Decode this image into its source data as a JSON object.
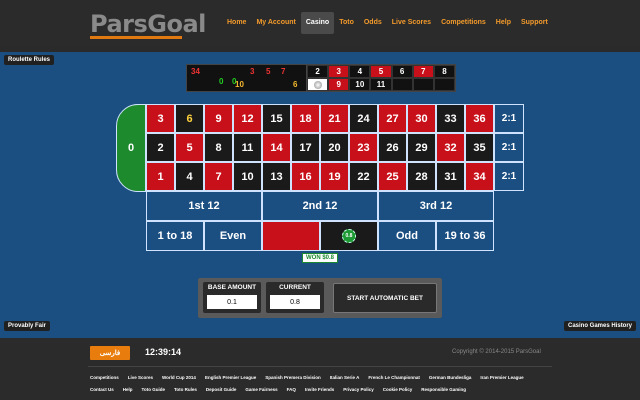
{
  "header": {
    "logo": "ParsGoal",
    "nav": [
      {
        "label": "Home",
        "active": false
      },
      {
        "label": "My Account",
        "active": false
      },
      {
        "label": "Casino",
        "active": true
      },
      {
        "label": "Toto",
        "active": false
      },
      {
        "label": "Odds",
        "active": false
      },
      {
        "label": "Live Scores",
        "active": false
      },
      {
        "label": "Competitions",
        "active": false
      },
      {
        "label": "Help",
        "active": false
      },
      {
        "label": "Support",
        "active": false
      }
    ]
  },
  "game": {
    "roulette_rules": "Roulette Rules",
    "provably_fair": "Provably Fair",
    "history_link": "Casino Games History",
    "stats": [
      {
        "value": "34",
        "color": "#e33"
      },
      {
        "value": "0",
        "color": "#2c2"
      },
      {
        "value": "0",
        "color": "#2c2"
      },
      {
        "value": "3",
        "color": "#e33"
      },
      {
        "value": "5",
        "color": "#e33"
      },
      {
        "value": "7",
        "color": "#e33"
      },
      {
        "value": "10",
        "color": "#f5b82e"
      },
      {
        "value": "6",
        "color": "#f5b82e"
      }
    ],
    "recent": [
      {
        "value": "2",
        "type": "black"
      },
      {
        "value": "3",
        "type": "red"
      },
      {
        "value": "4",
        "type": "black"
      },
      {
        "value": "5",
        "type": "red"
      },
      {
        "value": "6",
        "type": "black"
      },
      {
        "value": "7",
        "type": "red"
      },
      {
        "value": "8",
        "type": "black"
      },
      {
        "value": "",
        "type": "white",
        "ball": true
      },
      {
        "value": "9",
        "type": "red"
      },
      {
        "value": "10",
        "type": "black"
      },
      {
        "value": "11",
        "type": "black"
      },
      {
        "value": "",
        "type": "black"
      },
      {
        "value": "",
        "type": "black"
      },
      {
        "value": "",
        "type": "black"
      }
    ],
    "zero": "0",
    "rows": [
      [
        {
          "n": "3",
          "c": "red"
        },
        {
          "n": "6",
          "c": "black",
          "hl": true
        },
        {
          "n": "9",
          "c": "red"
        },
        {
          "n": "12",
          "c": "red"
        },
        {
          "n": "15",
          "c": "black"
        },
        {
          "n": "18",
          "c": "red"
        },
        {
          "n": "21",
          "c": "red"
        },
        {
          "n": "24",
          "c": "black"
        },
        {
          "n": "27",
          "c": "red"
        },
        {
          "n": "30",
          "c": "red"
        },
        {
          "n": "33",
          "c": "black"
        },
        {
          "n": "36",
          "c": "red"
        }
      ],
      [
        {
          "n": "2",
          "c": "black"
        },
        {
          "n": "5",
          "c": "red"
        },
        {
          "n": "8",
          "c": "black"
        },
        {
          "n": "11",
          "c": "black"
        },
        {
          "n": "14",
          "c": "red"
        },
        {
          "n": "17",
          "c": "black"
        },
        {
          "n": "20",
          "c": "black"
        },
        {
          "n": "23",
          "c": "red"
        },
        {
          "n": "26",
          "c": "black"
        },
        {
          "n": "29",
          "c": "black"
        },
        {
          "n": "32",
          "c": "red"
        },
        {
          "n": "35",
          "c": "black"
        }
      ],
      [
        {
          "n": "1",
          "c": "red"
        },
        {
          "n": "4",
          "c": "black"
        },
        {
          "n": "7",
          "c": "red"
        },
        {
          "n": "10",
          "c": "black"
        },
        {
          "n": "13",
          "c": "black"
        },
        {
          "n": "16",
          "c": "red"
        },
        {
          "n": "19",
          "c": "red"
        },
        {
          "n": "22",
          "c": "black"
        },
        {
          "n": "25",
          "c": "red"
        },
        {
          "n": "28",
          "c": "black"
        },
        {
          "n": "31",
          "c": "black"
        },
        {
          "n": "34",
          "c": "red"
        }
      ]
    ],
    "column_bet": "2:1",
    "dozens": [
      "1st 12",
      "2nd 12",
      "3rd 12"
    ],
    "outside": {
      "low": "1 to 18",
      "even": "Even",
      "red": "",
      "black_chip": "0.8",
      "odd": "Odd",
      "high": "19 to 36"
    },
    "won": "WON $0.8"
  },
  "controls": {
    "base_amount_label": "BASE AMOUNT",
    "base_amount_value": "0.1",
    "current_label": "CURRENT",
    "current_value": "0.8",
    "auto_bet_label": "START AUTOMATIC BET"
  },
  "footer": {
    "language": "فارسی",
    "clock": "12:39:14",
    "copyright": "Copyright © 2014-2015 ParsGoal",
    "links_row1": [
      "Competitions",
      "Live Scores",
      "World Cup 2014",
      "English Premier League",
      "Spanish Premera Division",
      "Italian Serie A",
      "French Le Championnat",
      "German Bundesliga",
      "Iran Premier League"
    ],
    "links_row2": [
      "Contact Us",
      "Help",
      "Toto Guide",
      "Toto Rules",
      "Deposit Guide",
      "Game Fairness",
      "FAQ",
      "Invite Friends",
      "Privacy Policy",
      "Cookie Policy",
      "Responsible Gaming"
    ]
  }
}
